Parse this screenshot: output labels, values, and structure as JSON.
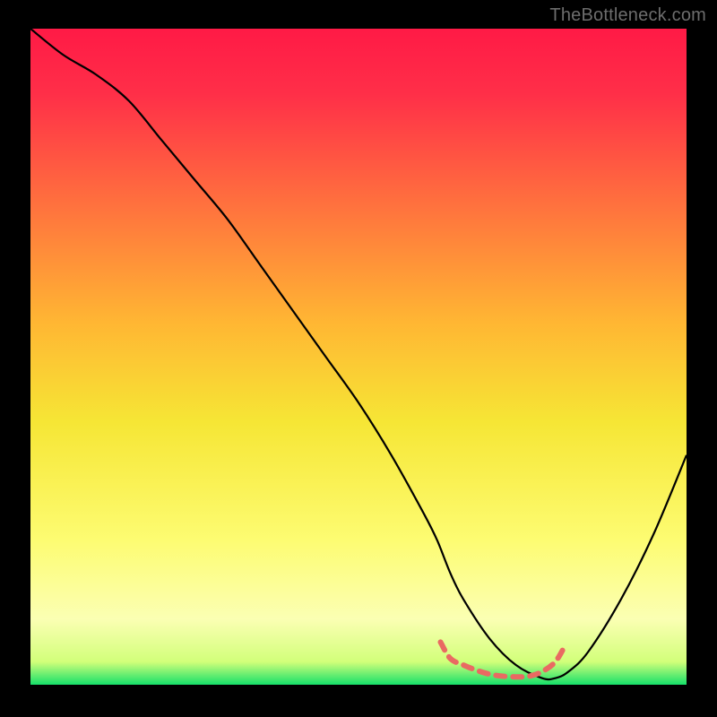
{
  "watermark": "TheBottleneck.com",
  "chart_data": {
    "type": "line",
    "title": "",
    "xlabel": "",
    "ylabel": "",
    "xlim": [
      0,
      100
    ],
    "ylim": [
      0,
      100
    ],
    "gradient_stops": [
      {
        "offset": 0.0,
        "color": "#ff1a46"
      },
      {
        "offset": 0.1,
        "color": "#ff2f48"
      },
      {
        "offset": 0.25,
        "color": "#ff6a3f"
      },
      {
        "offset": 0.45,
        "color": "#ffb733"
      },
      {
        "offset": 0.6,
        "color": "#f6e635"
      },
      {
        "offset": 0.78,
        "color": "#fdfc72"
      },
      {
        "offset": 0.9,
        "color": "#fbffb3"
      },
      {
        "offset": 0.965,
        "color": "#d2ff7a"
      },
      {
        "offset": 1.0,
        "color": "#16e06a"
      }
    ],
    "series": [
      {
        "name": "bottleneck-curve",
        "color": "#000000",
        "x": [
          0,
          5,
          10,
          15,
          20,
          25,
          30,
          35,
          40,
          45,
          50,
          55,
          60,
          62,
          64,
          66,
          70,
          74,
          78,
          80,
          82,
          85,
          90,
          95,
          100
        ],
        "y": [
          100,
          96,
          93,
          89,
          83,
          77,
          71,
          64,
          57,
          50,
          43,
          35,
          26,
          22,
          17,
          13,
          7,
          3,
          1,
          1,
          2,
          5,
          13,
          23,
          35
        ]
      },
      {
        "name": "optimal-band",
        "color": "#e96a62",
        "x": [
          62.5,
          64,
          66,
          68,
          70,
          72,
          74,
          76,
          78,
          80,
          81.5
        ],
        "y": [
          6.5,
          4,
          3,
          2.2,
          1.6,
          1.3,
          1.2,
          1.3,
          2.0,
          3.5,
          6.0
        ]
      }
    ],
    "annotations": []
  }
}
